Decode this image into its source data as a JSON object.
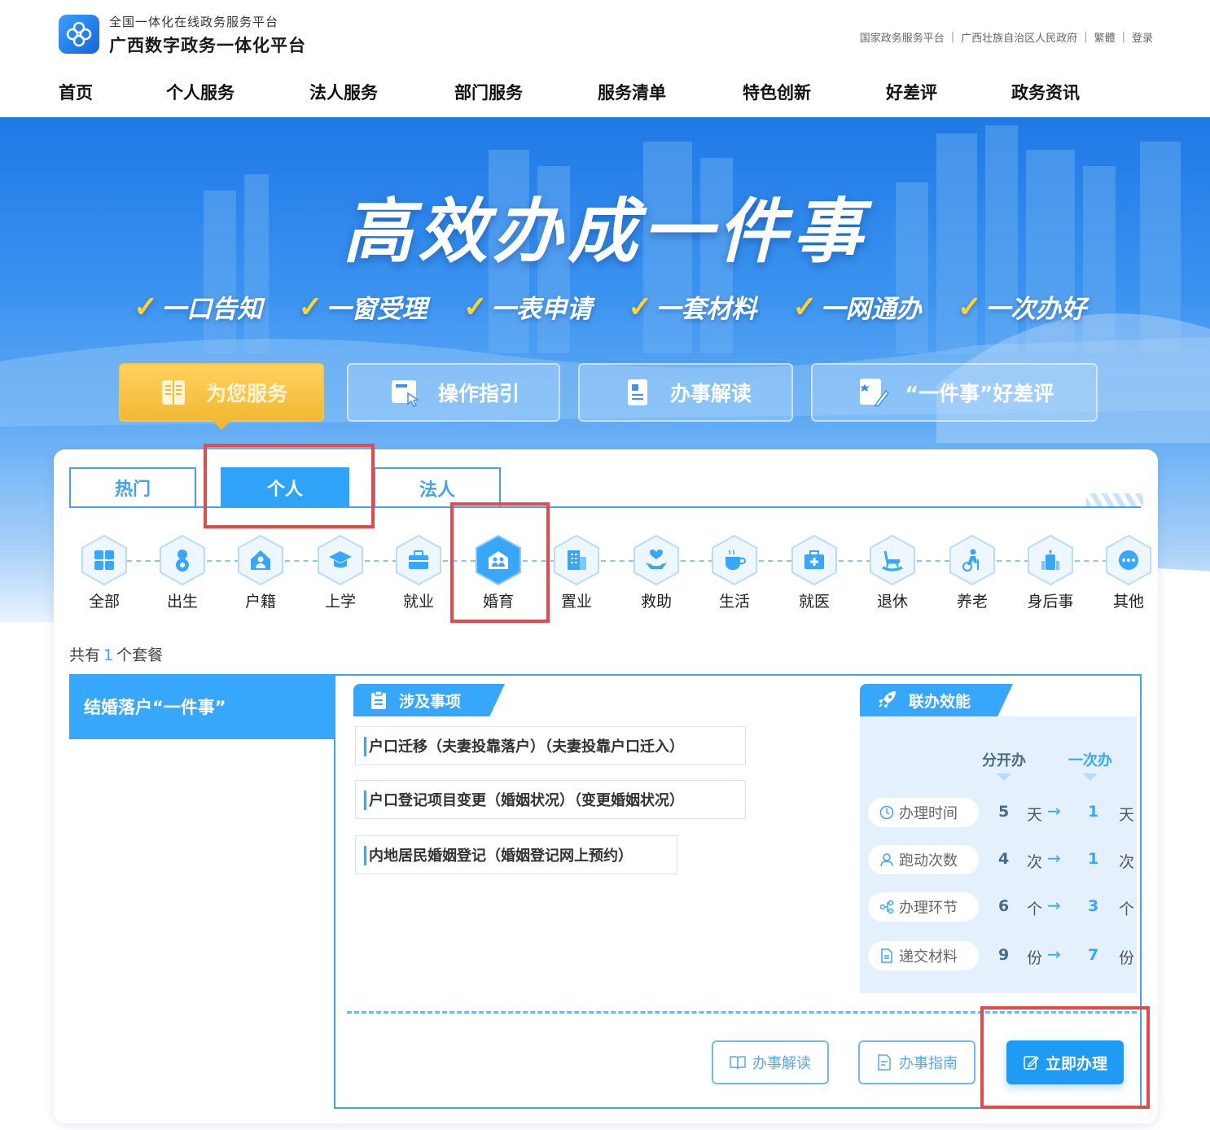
{
  "header": {
    "logo_sub": "全国一体化在线政务服务平台",
    "logo_title": "广西数字政务一体化平台",
    "top_links": [
      "国家政务服务平台",
      "广西壮族自治区人民政府",
      "繁體",
      "登录"
    ],
    "separator": "|"
  },
  "nav": [
    "首页",
    "个人服务",
    "法人服务",
    "部门服务",
    "服务清单",
    "特色创新",
    "好差评",
    "政务资讯"
  ],
  "hero": {
    "title": "高效办成一件事",
    "check_glyph": "✓",
    "slogans": [
      "一口告知",
      "一窗受理",
      "一表申请",
      "一套材料",
      "一网通办",
      "一次办好"
    ],
    "feature_buttons": [
      {
        "label": "为您服务",
        "icon": "book-icon",
        "active": true
      },
      {
        "label": "操作指引",
        "icon": "guide-icon",
        "active": false
      },
      {
        "label": "办事解读",
        "icon": "document-icon",
        "active": false
      },
      {
        "label": "“一件事”好差评",
        "icon": "rate-icon",
        "active": false
      }
    ]
  },
  "tabs": [
    "热门",
    "个人",
    "法人"
  ],
  "categories": [
    {
      "label": "全部",
      "icon": "grid-icon"
    },
    {
      "label": "出生",
      "icon": "baby-icon"
    },
    {
      "label": "户籍",
      "icon": "house-person-icon"
    },
    {
      "label": "上学",
      "icon": "graduation-cap-icon"
    },
    {
      "label": "就业",
      "icon": "briefcase-icon"
    },
    {
      "label": "婚育",
      "icon": "marriage-icon"
    },
    {
      "label": "置业",
      "icon": "building-icon"
    },
    {
      "label": "救助",
      "icon": "helping-hand-icon"
    },
    {
      "label": "生活",
      "icon": "cup-icon"
    },
    {
      "label": "就医",
      "icon": "medical-kit-icon"
    },
    {
      "label": "退休",
      "icon": "rocking-chair-icon"
    },
    {
      "label": "养老",
      "icon": "elderly-icon"
    },
    {
      "label": "身后事",
      "icon": "memorial-icon"
    },
    {
      "label": "其他",
      "icon": "more-icon"
    }
  ],
  "count": {
    "prefix": "共有",
    "num": "1",
    "suffix": "个套餐"
  },
  "package": {
    "name": "结婚落户“一件事”",
    "items_title": "涉及事项",
    "items": [
      "户口迁移（夫妻投靠落户）（夫妻投靠户口迁入）",
      "户口登记项目变更（婚姻状况）（变更婚姻状况）",
      "内地居民婚姻登记（婚姻登记网上预约）"
    ],
    "perf_title": "联办效能",
    "col_separate": "分开办",
    "col_once": "一次办",
    "arrow": "→",
    "metrics": [
      {
        "label": "办理时间",
        "icon": "clock-icon",
        "before": "5",
        "unit": "天",
        "after": "1"
      },
      {
        "label": "跑动次数",
        "icon": "person-icon",
        "before": "4",
        "unit": "次",
        "after": "1"
      },
      {
        "label": "办理环节",
        "icon": "flow-icon",
        "before": "6",
        "unit": "个",
        "after": "3"
      },
      {
        "label": "递交材料",
        "icon": "file-icon",
        "before": "9",
        "unit": "份",
        "after": "7"
      }
    ],
    "actions": {
      "interpret": "办事解读",
      "guide": "办事指南",
      "apply": "立即办理"
    }
  },
  "colors": {
    "accent": "#36a7fb",
    "highlight": "#e8484a",
    "gold": "#f3b834",
    "check": "#ffd428"
  }
}
